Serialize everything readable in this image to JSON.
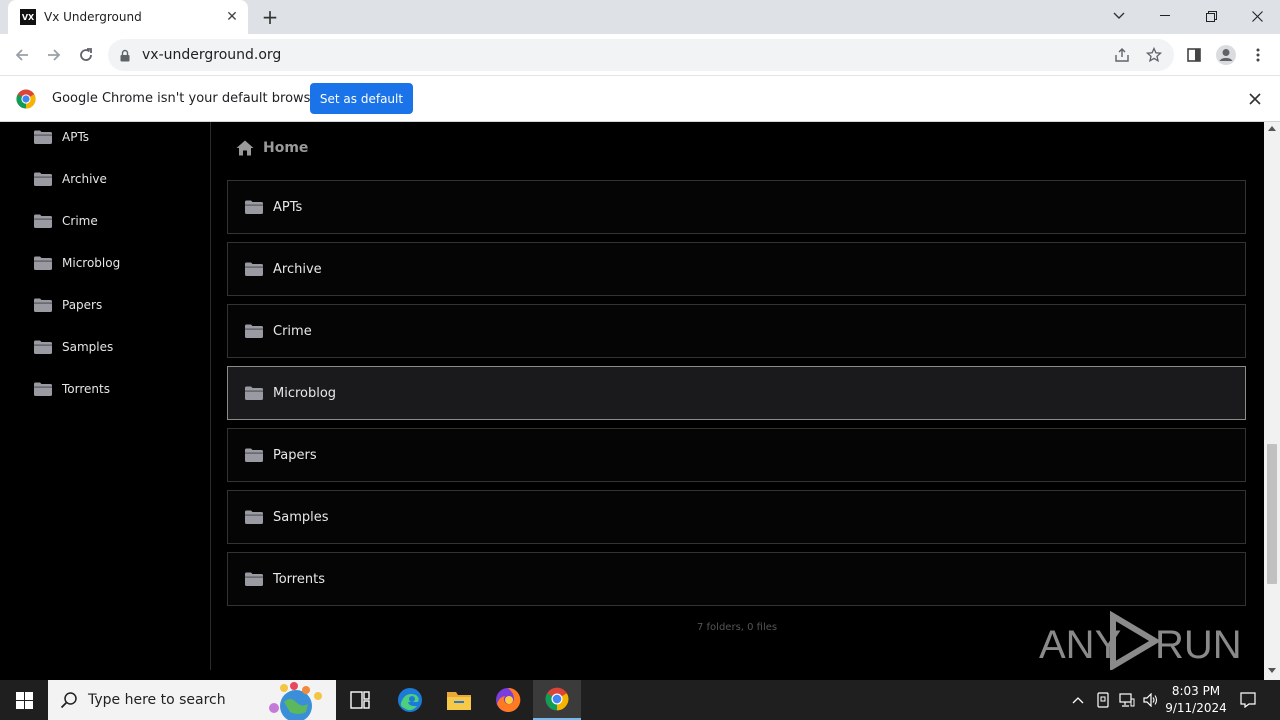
{
  "browser": {
    "tab_title": "Vx Underground",
    "tab_favicon_text": "VX",
    "url": "vx-underground.org"
  },
  "infobar": {
    "message": "Google Chrome isn't your default browser",
    "button_label": "Set as default"
  },
  "sidebar": {
    "items": [
      "APTs",
      "Archive",
      "Crime",
      "Microblog",
      "Papers",
      "Samples",
      "Torrents"
    ]
  },
  "main": {
    "breadcrumb": "Home",
    "folders": [
      {
        "name": "APTs"
      },
      {
        "name": "Archive"
      },
      {
        "name": "Crime"
      },
      {
        "name": "Microblog",
        "highlighted": true
      },
      {
        "name": "Papers"
      },
      {
        "name": "Samples"
      },
      {
        "name": "Torrents"
      }
    ],
    "summary": "7 folders, 0 files"
  },
  "watermark": {
    "text_left": "ANY",
    "text_right": "RUN"
  },
  "taskbar": {
    "search_placeholder": "Type here to search",
    "time": "8:03 PM",
    "date": "9/11/2024"
  },
  "colors": {
    "accent": "#1a73e8",
    "page_background": "#000000",
    "taskbar": "#1f1f1f"
  }
}
